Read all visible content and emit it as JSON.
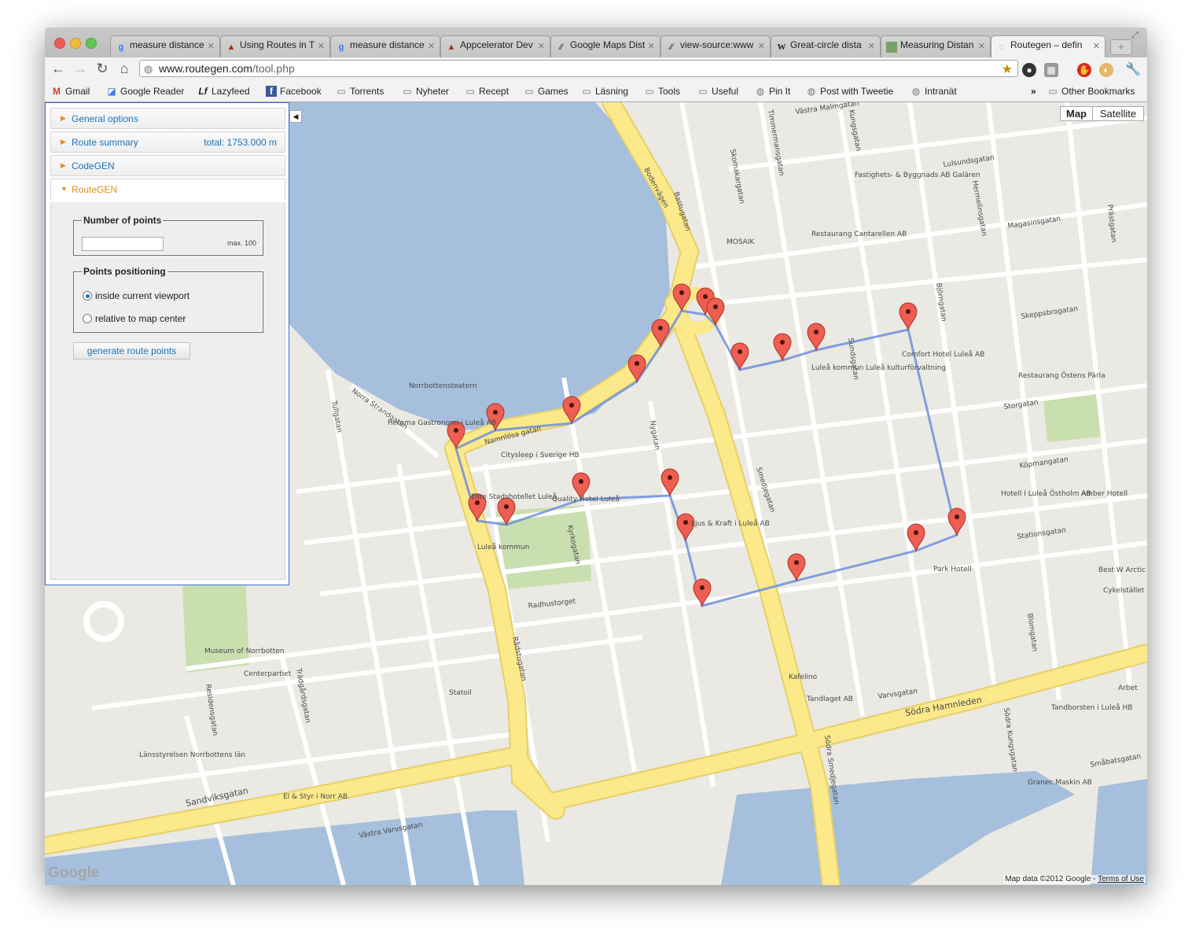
{
  "window": {
    "controls": [
      "close",
      "minimize",
      "zoom"
    ],
    "tabs": [
      {
        "title": "measure distance",
        "icon": "google-icon",
        "active": false
      },
      {
        "title": "Using Routes in T",
        "icon": "warning-icon",
        "active": false
      },
      {
        "title": "measure distance",
        "icon": "google-icon",
        "active": false
      },
      {
        "title": "Appcelerator Dev",
        "icon": "warning-icon",
        "active": false
      },
      {
        "title": "Google Maps Dist",
        "icon": "slash-icon",
        "active": false
      },
      {
        "title": "view-source:www",
        "icon": "slash-icon",
        "active": false
      },
      {
        "title": "Great-circle dista",
        "icon": "wikipedia-icon",
        "active": false
      },
      {
        "title": "Measuring Distan",
        "icon": "image-icon",
        "active": false
      },
      {
        "title": "Routegen – defin",
        "icon": "globe-icon",
        "active": true
      }
    ]
  },
  "toolbar": {
    "url_host": "www.routegen.com",
    "url_path": "/tool.php"
  },
  "bookmarks": [
    {
      "label": "Gmail",
      "icon": "gmail-icon"
    },
    {
      "label": "Google Reader",
      "icon": "reader-icon"
    },
    {
      "label": "Lazyfeed",
      "icon": "lf-icon"
    },
    {
      "label": "Facebook",
      "icon": "facebook-icon"
    },
    {
      "label": "Torrents",
      "icon": "folder-icon"
    },
    {
      "label": "Nyheter",
      "icon": "folder-icon"
    },
    {
      "label": "Recept",
      "icon": "folder-icon"
    },
    {
      "label": "Games",
      "icon": "folder-icon"
    },
    {
      "label": "Läsning",
      "icon": "folder-icon"
    },
    {
      "label": "Tools",
      "icon": "folder-icon"
    },
    {
      "label": "Useful",
      "icon": "folder-icon"
    },
    {
      "label": "Pin It",
      "icon": "globe-icon"
    },
    {
      "label": "Post with Tweetie",
      "icon": "globe-icon"
    },
    {
      "label": "Intranät",
      "icon": "globe-icon"
    }
  ],
  "other_bookmarks": "Other Bookmarks",
  "panel": {
    "general_options": "General options",
    "route_summary": "Route summary",
    "route_total": "total: 1753.000 m",
    "codegen": "CodeGEN",
    "routegen": "RouteGEN",
    "number_of_points": {
      "legend": "Number of points",
      "value": "",
      "max_label": "max. 100"
    },
    "points_positioning": {
      "legend": "Points positioning",
      "options": [
        {
          "label": "inside current viewport",
          "selected": true
        },
        {
          "label": "relative to map center",
          "selected": false
        }
      ]
    },
    "generate_button": "generate route points"
  },
  "map": {
    "map_type_buttons": [
      {
        "label": "Map",
        "selected": true
      },
      {
        "label": "Satellite",
        "selected": false
      }
    ],
    "attribution": "Map data ©2012 Google - ",
    "terms": "Terms of Use",
    "logo": "Google",
    "colors": {
      "water": "#a5bfdd",
      "land": "#ebe9e3",
      "major_road": "#fbe98a",
      "park": "#c9dfaf",
      "route": "#6f8fdc",
      "marker": "#ee5e51"
    },
    "marker_count": 20,
    "labels": {
      "streets": [
        "Bodenvägen",
        "Bastugatan",
        "Skomakargatan",
        "Timmermansgatan",
        "Kungsgatan",
        "Hermelinsgatan",
        "Prästgatan",
        "Lulsundsgatan",
        "Magasinsgatan",
        "Skeppsbrogatan",
        "Storgatan",
        "Köpmangatan",
        "Stationsgatan",
        "Smedjegatan",
        "Nygatan",
        "Namnlösa gatan",
        "Rådstugatan",
        "Kyrkogatan",
        "Tullgatan",
        "Norra Strandgatan",
        "Radhustorget",
        "Trädgårdsgatan",
        "Residensgatan",
        "Sandviksgatan",
        "Södra Hamnleden",
        "Varvsgatan",
        "Västra Varvsgatan",
        "Södra Smedjegatan",
        "Södra Kungsgatan",
        "Blomgatan",
        "Västra Malmgatan",
        "Björngatan",
        "Sundsgatan",
        "Småbatsgatan"
      ],
      "places": [
        "Fastighets- & Byggnads AB Galären",
        "Restaurang Cantarellen AB",
        "MOSAIK",
        "Norrbottensteatern",
        "Hemma Gastronomi i Luleå AB",
        "Citysleep i Sverige HB",
        "Elite Stadshotellet Luleå",
        "Quality Hotel Luleå",
        "Ljus & Kraft i Luleå AB",
        "Luleå kommun Luleå kulturförvaltning",
        "Comfort Hotel Luleå AB",
        "Restaurang Östens Pärla",
        "Hotell I Luleå Östholm AB",
        "Amber Hotell",
        "Park Hotell",
        "Best W Arctic Hot",
        "Cykelstället i Luleå",
        "Luleå kommun",
        "Museum of Norrbotten",
        "Centerpartiet",
        "Statoil",
        "Kafelino",
        "Tandlaget AB",
        "Tandborsten i Luleå HB",
        "Arbet",
        "Granec Maskin AB",
        "Länsstyrelsen Norrbottens län",
        "El & Styr i Norr AB"
      ]
    }
  }
}
